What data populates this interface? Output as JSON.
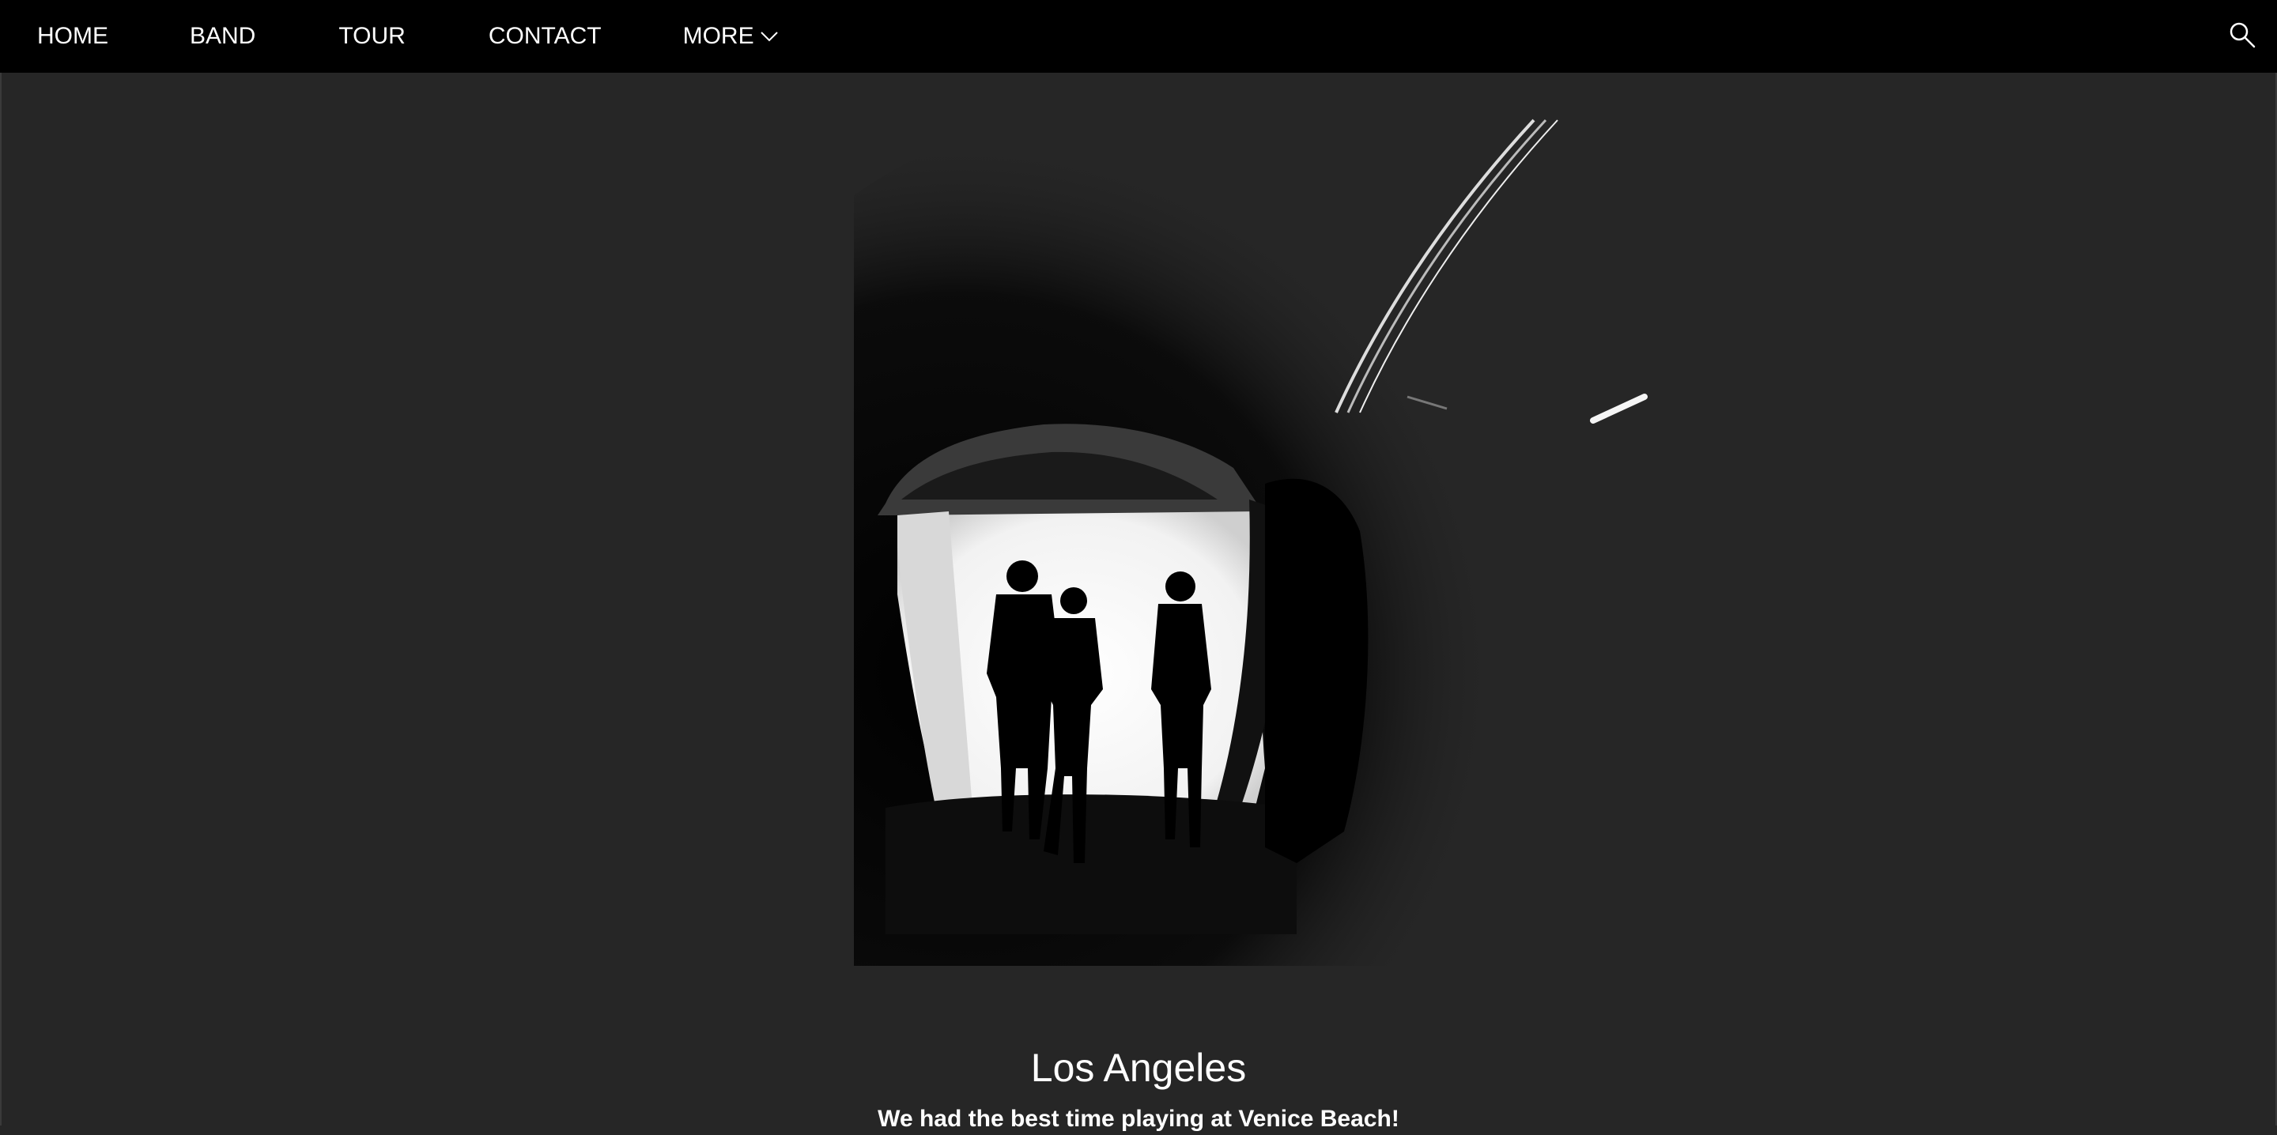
{
  "nav": {
    "items": [
      {
        "label": "HOME"
      },
      {
        "label": "BAND"
      },
      {
        "label": "TOUR"
      },
      {
        "label": "CONTACT"
      },
      {
        "label": "MORE"
      }
    ],
    "more_icon": "chevron-down-icon",
    "search_icon": "search-icon"
  },
  "hero": {
    "image": "silhouettes-in-tunnel-photo",
    "title": "Los Angeles",
    "text": "We had the best time playing at Venice Beach!"
  },
  "colors": {
    "nav_background": "#000000",
    "page_background": "#262626",
    "text": "#ffffff"
  }
}
